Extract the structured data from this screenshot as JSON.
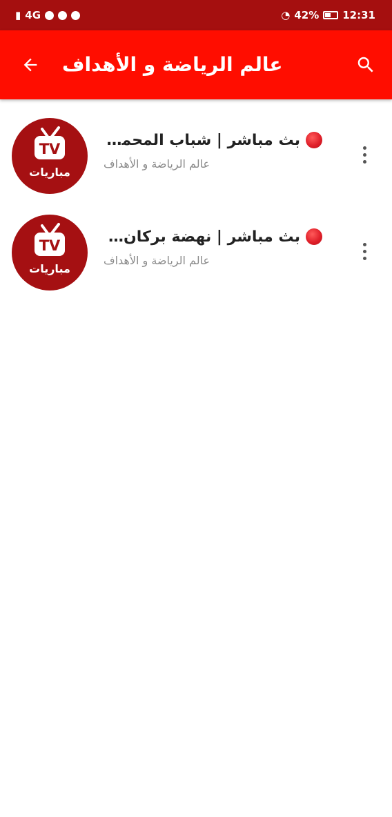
{
  "status_bar": {
    "left_text": "4G",
    "battery": "42%",
    "time": "12:31"
  },
  "app_bar": {
    "title": "عالم الرياضة و الأهداف",
    "back_icon": "arrow-back-icon",
    "search_icon": "search-icon",
    "background": "#ff0d00"
  },
  "items": [
    {
      "title": "بث مباشر | شباب المحمدية",
      "subtitle": "عالم الرياضة و الأهداف",
      "thumb_label": "TV",
      "thumb_caption": "مباريات"
    },
    {
      "title": "بث مباشر | نهضة بركان | ...",
      "subtitle": "عالم الرياضة و الأهداف",
      "thumb_label": "TV",
      "thumb_caption": "مباريات"
    }
  ]
}
